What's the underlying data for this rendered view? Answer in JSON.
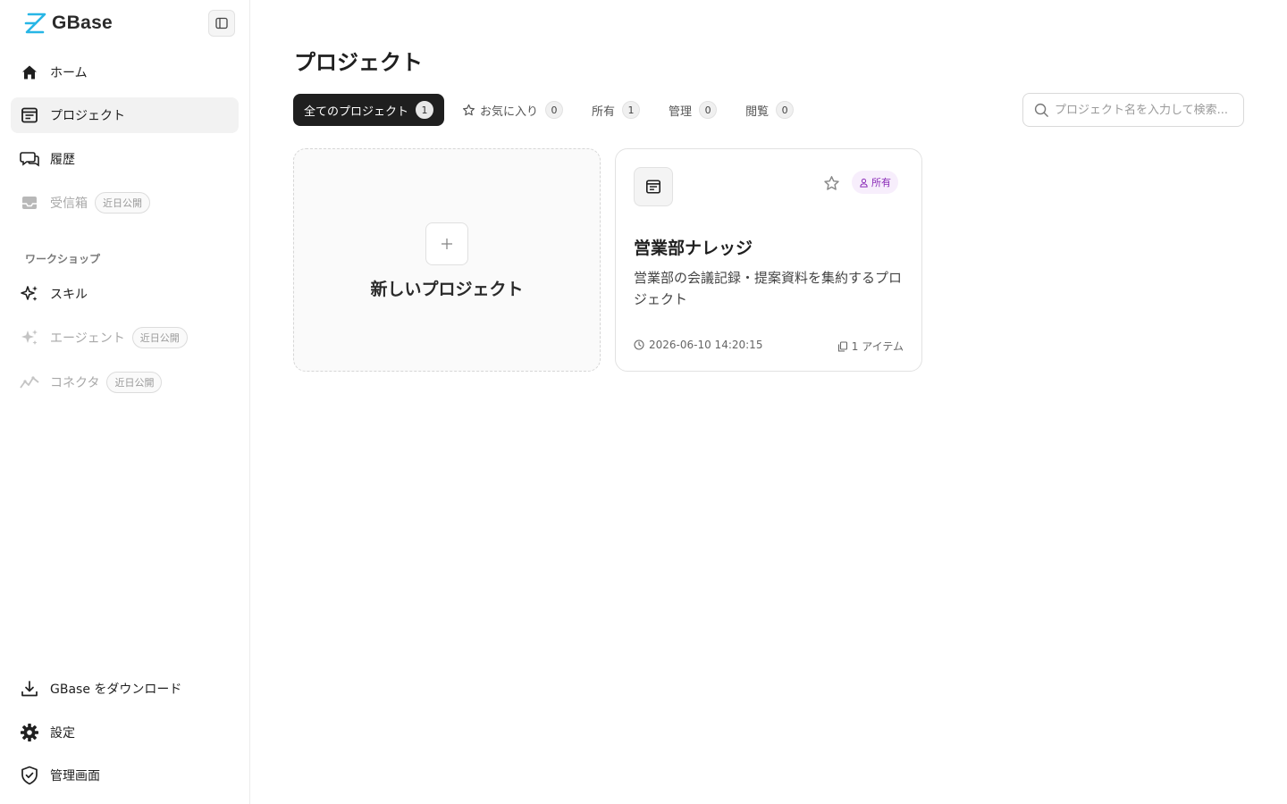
{
  "app": {
    "name": "GBase"
  },
  "sidebar": {
    "items": [
      {
        "label": "ホーム"
      },
      {
        "label": "プロジェクト"
      },
      {
        "label": "履歴"
      },
      {
        "label": "受信箱",
        "badge": "近日公開"
      }
    ],
    "section_title": "ワークショップ",
    "workshop_items": [
      {
        "label": "スキル"
      },
      {
        "label": "エージェント",
        "badge": "近日公開"
      },
      {
        "label": "コネクタ",
        "badge": "近日公開"
      }
    ],
    "bottom_items": [
      {
        "label": "GBase をダウンロード"
      },
      {
        "label": "設定"
      },
      {
        "label": "管理画面"
      }
    ]
  },
  "main": {
    "title": "プロジェクト",
    "tabs": [
      {
        "label": "全てのプロジェクト",
        "count": "1"
      },
      {
        "label": "お気に入り",
        "count": "0"
      },
      {
        "label": "所有",
        "count": "1"
      },
      {
        "label": "管理",
        "count": "0"
      },
      {
        "label": "閲覧",
        "count": "0"
      }
    ],
    "search": {
      "placeholder": "プロジェクト名を入力して検索..."
    },
    "new_project_label": "新しいプロジェクト",
    "project": {
      "name": "営業部ナレッジ",
      "description": "営業部の会議記録・提案資料を集約するプロジェクト",
      "badge": "所有",
      "updated": "2026-06-10 14:20:15",
      "items": "1 アイテム"
    }
  },
  "colors": {
    "accent": "#1f1f1f",
    "owner_badge": "#8a2bb8",
    "logo": "#27b6e6"
  }
}
